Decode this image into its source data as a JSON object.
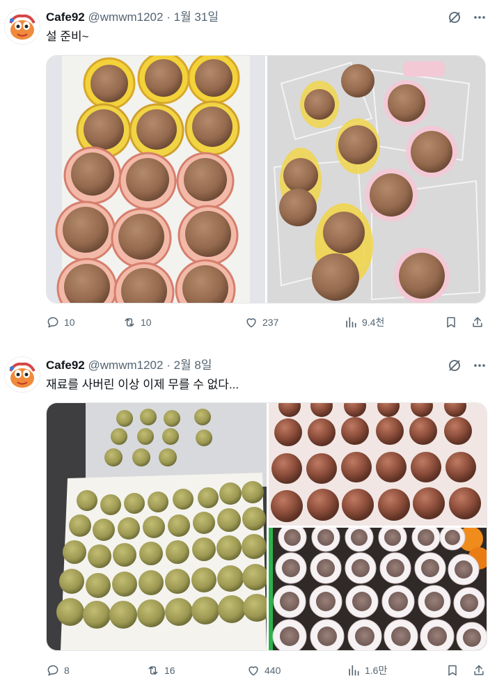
{
  "tweets": [
    {
      "display_name": "Cafe92",
      "handle": "@wmwm1202",
      "separator": "·",
      "date": "1월 31일",
      "text": "설 준비~",
      "stats": {
        "replies": "10",
        "retweets": "10",
        "likes": "237",
        "views": "9.4천"
      }
    },
    {
      "display_name": "Cafe92",
      "handle": "@wmwm1202",
      "separator": "·",
      "date": "2월 8일",
      "text": "재료를 사버린 이상 이제 무를 수 없다...",
      "stats": {
        "replies": "8",
        "retweets": "16",
        "likes": "440",
        "views": "1.6만"
      }
    }
  ],
  "icons": {
    "grok": "slashed-circle-icon",
    "more": "more-horizontal-icon",
    "reply": "reply-icon",
    "retweet": "retweet-icon",
    "like": "heart-icon",
    "views": "analytics-icon",
    "bookmark": "bookmark-icon",
    "share": "share-icon"
  },
  "colors": {
    "text": "#0f1419",
    "secondary": "#536471",
    "cocoa": "#9a7257",
    "matcha": "#9c9a50",
    "chocolate": "#8a4f3c"
  }
}
